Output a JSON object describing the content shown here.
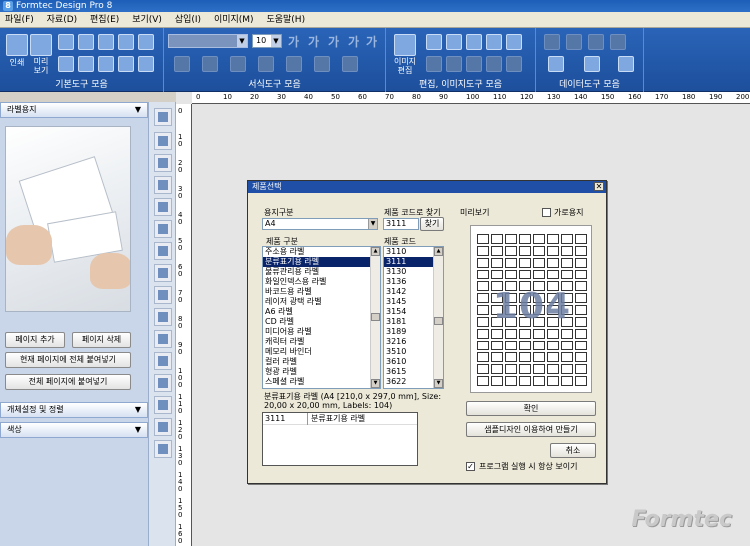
{
  "window": {
    "title": "Formtec Design Pro 8",
    "app_icon": "8"
  },
  "menu": [
    "파일(F)",
    "자료(D)",
    "편집(E)",
    "보기(V)",
    "삽입(I)",
    "이미지(M)",
    "도움말(H)"
  ],
  "ribbon": {
    "groups": [
      "기본도구 모음",
      "서식도구 모음",
      "편집, 이미지도구 모음",
      "데이터도구 모음"
    ],
    "print_label": "인쇄",
    "preview_label": "미리\n보기",
    "image_edit_label": "이미지\n편집",
    "font_size": "10",
    "font_style_glyphs": [
      "가",
      "가",
      "가",
      "가",
      "가"
    ]
  },
  "left_panel": {
    "header": "라벨용지",
    "add_page": "페이지 추가",
    "delete_page": "페이지 삭제",
    "paste_current": "현재 페이지에 전체 붙여넣기",
    "paste_all": "전체 페이지에 붙여넣기",
    "section_object": "개체설정 및 정렬",
    "section_color": "색상"
  },
  "ruler": {
    "h_numbers": [
      "0",
      "10",
      "20",
      "30",
      "40",
      "50",
      "60",
      "70",
      "80",
      "90",
      "100",
      "110",
      "120",
      "130",
      "140",
      "150",
      "160",
      "170",
      "180",
      "190",
      "200"
    ],
    "v_numbers": [
      "0",
      "10",
      "20",
      "30",
      "40",
      "50",
      "60",
      "70",
      "80",
      "90",
      "100",
      "110",
      "120",
      "130",
      "140",
      "150",
      "160",
      "170"
    ]
  },
  "brand": "Formtec",
  "dialog": {
    "title": "제품선택",
    "paper_type_label": "용지구분",
    "paper_type_value": "A4",
    "find_code_label": "제품 코드로 찾기",
    "find_code_value": "3111",
    "find_button": "찾기",
    "product_type_label": "제품 구분",
    "product_code_label": "제품 코드",
    "preview_label": "미리보기",
    "landscape_label": "가로용지",
    "product_types": [
      "주소용 라벨",
      "분류표기용 라벨",
      "물류관리용 라벨",
      "화일인덱스용 라벨",
      "바코드용 라벨",
      "레이저 광택 라벨",
      "A6 라벨",
      "CD 라벨",
      "미디어용 라벨",
      "캐릭터 라벨",
      "메모리 바인더",
      "컬러 라벨",
      "형광 라벨",
      "스페셜 라벨"
    ],
    "product_type_selected": 1,
    "product_codes": [
      "3110",
      "3111",
      "3130",
      "3136",
      "3142",
      "3145",
      "3154",
      "3181",
      "3189",
      "3216",
      "3510",
      "3610",
      "3615",
      "3622"
    ],
    "product_code_selected": 1,
    "preview_count": "104",
    "description": "분류표기용 라벨 (A4 [210,0 x 297,0 mm], Size: 20,00 x 20,00 mm, Labels: 104)",
    "result_row": {
      "code": "3111",
      "name": "분류표기용 라벨"
    },
    "confirm": "확인",
    "sample_design": "샘플디자인 이용하여 만들기",
    "cancel": "취소",
    "show_on_start": "프로그램 실행 시 항상 보이기"
  }
}
